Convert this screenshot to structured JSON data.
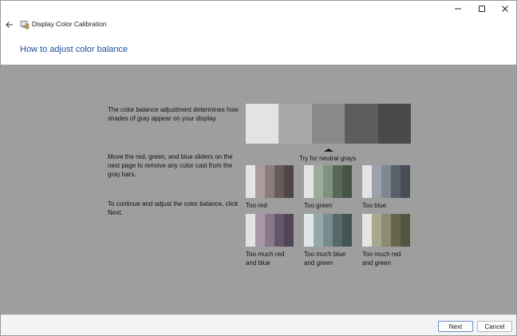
{
  "window": {
    "app_title": "Display Color Calibration",
    "page_title": "How to adjust color balance",
    "icons": {
      "back": "back-arrow-icon",
      "app": "display-calibration-icon",
      "minimize": "minimize-icon",
      "maximize": "maximize-icon",
      "close": "close-icon"
    }
  },
  "content": {
    "paragraph1": "The color balance adjustment determines how shades of gray appear on your display.",
    "paragraph2": "Move the red, green, and blue sliders on the next page to remove any color cast from the gray bars.",
    "paragraph3": "To continue and adjust the color balance, click Next.",
    "neutral_label": "Try for neutral grays",
    "neutral_bar_colors": [
      "#e3e3e3",
      "#a9a9a9",
      "#8a8a8a",
      "#5d5d5d",
      "#4a4a4a"
    ],
    "examples": [
      {
        "label": "Too red",
        "colors": [
          "#e6e3e3",
          "#a89c9c",
          "#8c7c7c",
          "#665a5a",
          "#4f4747"
        ]
      },
      {
        "label": "Too green",
        "colors": [
          "#e3e6e3",
          "#9bac9b",
          "#7f937f",
          "#586858",
          "#465446"
        ]
      },
      {
        "label": "Too blue",
        "colors": [
          "#e3e3e6",
          "#9ca3ac",
          "#7f8793",
          "#5a606a",
          "#474c56"
        ]
      },
      {
        "label": "Too much red and blue",
        "colors": [
          "#e6e1e6",
          "#a898a8",
          "#8c788c",
          "#66566a",
          "#4f4556"
        ]
      },
      {
        "label": "Too much blue and green",
        "colors": [
          "#e1e6e6",
          "#98a8aa",
          "#778c8e",
          "#566868",
          "#445454"
        ]
      },
      {
        "label": "Too much red and green",
        "colors": [
          "#e6e6e1",
          "#a8a88f",
          "#8c8c70",
          "#666650",
          "#545440"
        ]
      }
    ]
  },
  "footer": {
    "next_label": "Next",
    "cancel_label": "Cancel"
  }
}
